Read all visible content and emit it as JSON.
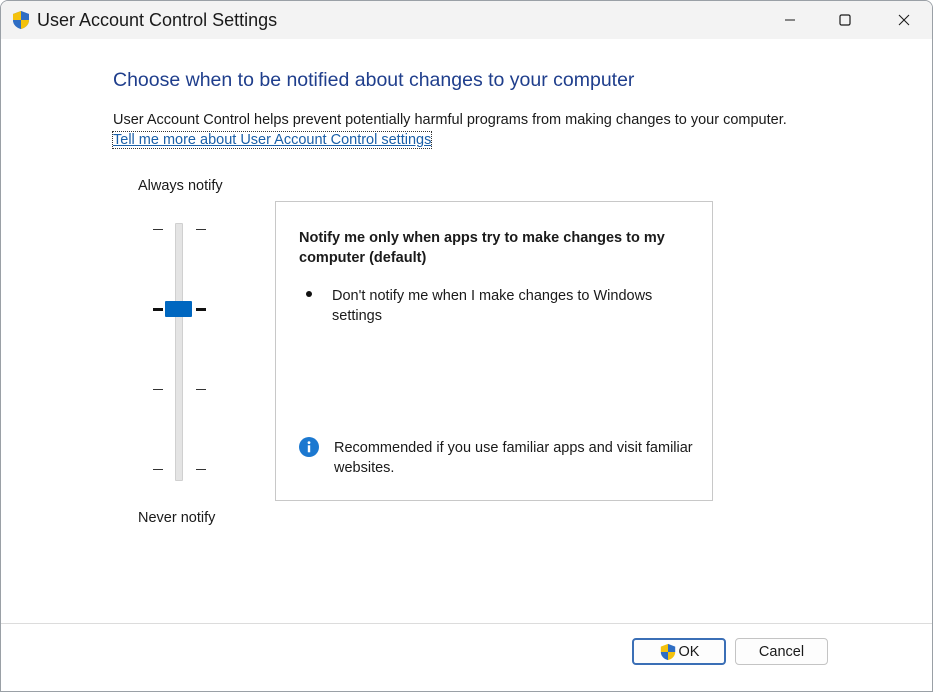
{
  "window": {
    "title": "User Account Control Settings",
    "controls": [
      "minimize",
      "maximize",
      "close"
    ]
  },
  "main": {
    "heading": "Choose when to be notified about changes to your computer",
    "description": "User Account Control helps prevent potentially harmful programs from making changes to your computer.",
    "link": "Tell me more about User Account Control settings"
  },
  "slider": {
    "top_label": "Always notify",
    "bottom_label": "Never notify",
    "levels": 4,
    "selected_level": 3
  },
  "info_panel": {
    "title": "Notify me only when apps try to make changes to my computer (default)",
    "bullet": "Don't notify me when I make changes to Windows settings",
    "recommendation": "Recommended if you use familiar apps and visit familiar websites."
  },
  "footer": {
    "ok_label": "OK",
    "cancel_label": "Cancel"
  },
  "colors": {
    "accent": "#0067c0",
    "heading": "#1f3e8c",
    "link": "#1a5fa8"
  }
}
